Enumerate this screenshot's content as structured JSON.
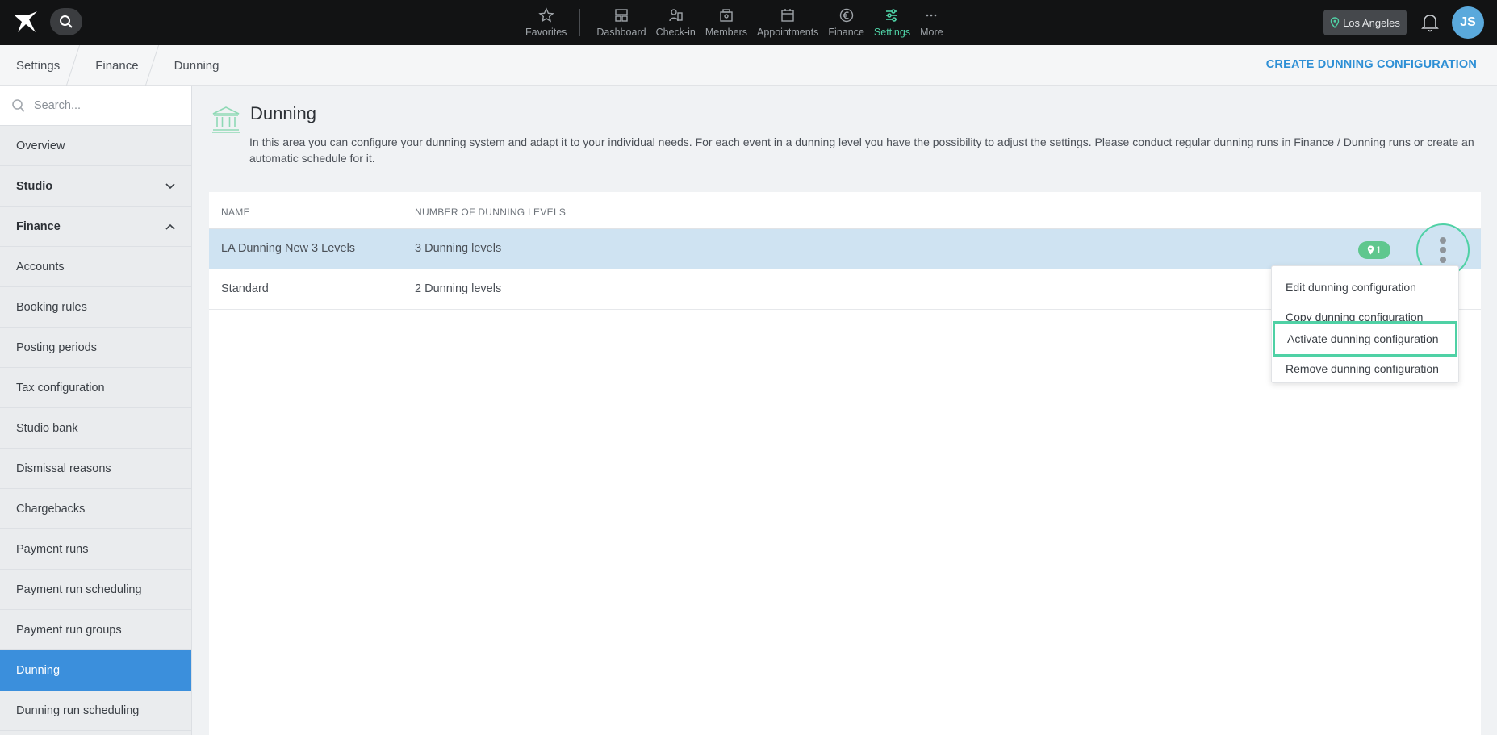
{
  "nav": {
    "items": [
      {
        "label": "Favorites"
      },
      {
        "label": "Dashboard"
      },
      {
        "label": "Check-in"
      },
      {
        "label": "Members"
      },
      {
        "label": "Appointments"
      },
      {
        "label": "Finance"
      },
      {
        "label": "Settings"
      },
      {
        "label": "More"
      }
    ],
    "location": "Los Angeles",
    "avatar_initials": "JS",
    "accent_color": "#4fd1a5"
  },
  "breadcrumb": {
    "items": [
      "Settings",
      "Finance",
      "Dunning"
    ],
    "action_label": "CREATE DUNNING CONFIGURATION"
  },
  "sidebar": {
    "search_placeholder": "Search...",
    "items": [
      {
        "label": "Overview"
      },
      {
        "label": "Studio"
      },
      {
        "label": "Finance"
      },
      {
        "label": "Accounts"
      },
      {
        "label": "Booking rules"
      },
      {
        "label": "Posting periods"
      },
      {
        "label": "Tax configuration"
      },
      {
        "label": "Studio bank"
      },
      {
        "label": "Dismissal reasons"
      },
      {
        "label": "Chargebacks"
      },
      {
        "label": "Payment runs"
      },
      {
        "label": "Payment run scheduling"
      },
      {
        "label": "Payment run groups"
      },
      {
        "label": "Dunning"
      },
      {
        "label": "Dunning run scheduling"
      }
    ]
  },
  "main": {
    "title": "Dunning",
    "description": "In this area you can configure your dunning system and adapt it to your individual needs. For each event in a dunning level you have the possibility to adjust the settings. Please conduct regular dunning runs in Finance / Dunning runs or create an automatic schedule for it.",
    "table": {
      "columns": [
        "NAME",
        "NUMBER OF DUNNING LEVELS"
      ],
      "rows": [
        {
          "name": "LA Dunning New 3 Levels",
          "levels": "3 Dunning levels",
          "badge": "1"
        },
        {
          "name": "Standard",
          "levels": "2 Dunning levels"
        }
      ]
    },
    "context_menu": {
      "items": [
        "Edit dunning configuration",
        "Copy dunning configuration",
        "Activate dunning configuration",
        "Remove dunning configuration"
      ]
    }
  }
}
